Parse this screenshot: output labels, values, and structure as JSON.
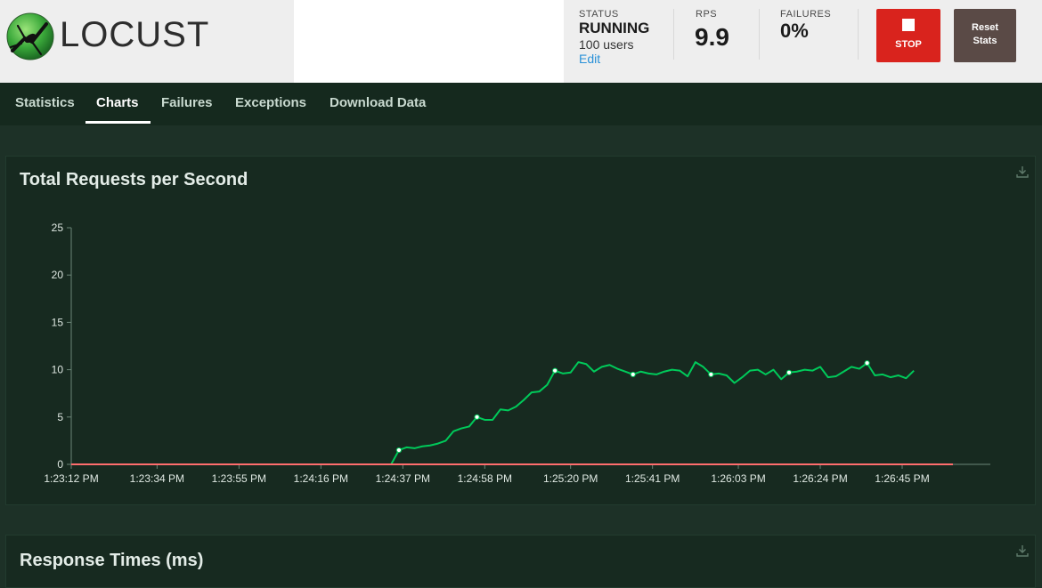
{
  "app": {
    "logo_text": "LOCUST"
  },
  "status": {
    "label": "STATUS",
    "value": "RUNNING",
    "users": "100 users",
    "edit_label": "Edit"
  },
  "rps": {
    "label": "RPS",
    "value": "9.9"
  },
  "failures": {
    "label": "FAILURES",
    "value": "0%"
  },
  "buttons": {
    "stop_label": "STOP",
    "reset_line1": "Reset",
    "reset_line2": "Stats"
  },
  "nav": {
    "tabs": [
      {
        "label": "Statistics"
      },
      {
        "label": "Charts"
      },
      {
        "label": "Failures"
      },
      {
        "label": "Exceptions"
      },
      {
        "label": "Download Data"
      }
    ],
    "active_tab": "Charts"
  },
  "panels": {
    "rps_title": "Total Requests per Second",
    "response_title": "Response Times (ms)"
  },
  "colors": {
    "rps_line": "#00ca5a",
    "failures_line": "#ff6d6d",
    "stop": "#d9231d",
    "reset": "#5a4a46",
    "link": "#2a91d8"
  },
  "icons": {
    "download": "download-icon",
    "logo": "locust-logo-icon",
    "stop": "stop-square-icon"
  },
  "chart_data": {
    "type": "line",
    "title": "Total Requests per Second",
    "xlabel": "",
    "ylabel": "",
    "ylim": [
      0,
      25
    ],
    "yticks": [
      0,
      5,
      10,
      15,
      20,
      25
    ],
    "xtick_labels": [
      "1:23:12 PM",
      "1:23:34 PM",
      "1:23:55 PM",
      "1:24:16 PM",
      "1:24:37 PM",
      "1:24:58 PM",
      "1:25:20 PM",
      "1:25:41 PM",
      "1:26:03 PM",
      "1:26:24 PM",
      "1:26:45 PM"
    ],
    "x_start": "1:23:12 PM",
    "x_end": "1:26:58 PM",
    "grid": false,
    "series": [
      {
        "color": "#00ca5a",
        "points": [
          [
            "1:24:34 PM",
            0
          ],
          [
            "1:24:36 PM",
            1.5
          ],
          [
            "1:24:38 PM",
            1.8
          ],
          [
            "1:24:40 PM",
            1.7
          ],
          [
            "1:24:42 PM",
            1.9
          ],
          [
            "1:24:44 PM",
            2.0
          ],
          [
            "1:24:46 PM",
            2.2
          ],
          [
            "1:24:48 PM",
            2.5
          ],
          [
            "1:24:50 PM",
            3.5
          ],
          [
            "1:24:52 PM",
            3.8
          ],
          [
            "1:24:54 PM",
            4.0
          ],
          [
            "1:24:56 PM",
            5.0
          ],
          [
            "1:24:58 PM",
            4.7
          ],
          [
            "1:25:00 PM",
            4.7
          ],
          [
            "1:25:02 PM",
            5.8
          ],
          [
            "1:25:04 PM",
            5.7
          ],
          [
            "1:25:06 PM",
            6.1
          ],
          [
            "1:25:08 PM",
            6.8
          ],
          [
            "1:25:10 PM",
            7.6
          ],
          [
            "1:25:12 PM",
            7.7
          ],
          [
            "1:25:14 PM",
            8.4
          ],
          [
            "1:25:16 PM",
            9.9
          ],
          [
            "1:25:18 PM",
            9.6
          ],
          [
            "1:25:20 PM",
            9.7
          ],
          [
            "1:25:22 PM",
            10.8
          ],
          [
            "1:25:24 PM",
            10.6
          ],
          [
            "1:25:26 PM",
            9.8
          ],
          [
            "1:25:28 PM",
            10.3
          ],
          [
            "1:25:30 PM",
            10.5
          ],
          [
            "1:25:32 PM",
            10.1
          ],
          [
            "1:25:34 PM",
            9.8
          ],
          [
            "1:25:36 PM",
            9.5
          ],
          [
            "1:25:38 PM",
            9.8
          ],
          [
            "1:25:40 PM",
            9.6
          ],
          [
            "1:25:42 PM",
            9.5
          ],
          [
            "1:25:44 PM",
            9.8
          ],
          [
            "1:25:46 PM",
            10.0
          ],
          [
            "1:25:48 PM",
            9.9
          ],
          [
            "1:25:50 PM",
            9.3
          ],
          [
            "1:25:52 PM",
            10.8
          ],
          [
            "1:25:54 PM",
            10.3
          ],
          [
            "1:25:56 PM",
            9.5
          ],
          [
            "1:25:58 PM",
            9.6
          ],
          [
            "1:26:00 PM",
            9.4
          ],
          [
            "1:26:02 PM",
            8.6
          ],
          [
            "1:26:04 PM",
            9.2
          ],
          [
            "1:26:06 PM",
            9.9
          ],
          [
            "1:26:08 PM",
            10.0
          ],
          [
            "1:26:10 PM",
            9.5
          ],
          [
            "1:26:12 PM",
            10.0
          ],
          [
            "1:26:14 PM",
            9.0
          ],
          [
            "1:26:16 PM",
            9.7
          ],
          [
            "1:26:18 PM",
            9.8
          ],
          [
            "1:26:20 PM",
            10.0
          ],
          [
            "1:26:22 PM",
            9.9
          ],
          [
            "1:26:24 PM",
            10.3
          ],
          [
            "1:26:26 PM",
            9.2
          ],
          [
            "1:26:28 PM",
            9.3
          ],
          [
            "1:26:30 PM",
            9.8
          ],
          [
            "1:26:32 PM",
            10.3
          ],
          [
            "1:26:34 PM",
            10.1
          ],
          [
            "1:26:36 PM",
            10.7
          ],
          [
            "1:26:38 PM",
            9.4
          ],
          [
            "1:26:40 PM",
            9.5
          ],
          [
            "1:26:42 PM",
            9.2
          ],
          [
            "1:26:44 PM",
            9.4
          ],
          [
            "1:26:46 PM",
            9.1
          ],
          [
            "1:26:48 PM",
            9.9
          ]
        ],
        "markers": [
          [
            "1:24:36 PM",
            1.5
          ],
          [
            "1:24:56 PM",
            5.0
          ],
          [
            "1:25:16 PM",
            9.9
          ],
          [
            "1:25:36 PM",
            9.5
          ],
          [
            "1:25:56 PM",
            9.5
          ],
          [
            "1:26:16 PM",
            9.7
          ],
          [
            "1:26:36 PM",
            10.7
          ]
        ]
      },
      {
        "color": "#ff6d6d",
        "points": [
          [
            "1:23:12 PM",
            0
          ],
          [
            "1:26:58 PM",
            0
          ]
        ]
      }
    ]
  }
}
